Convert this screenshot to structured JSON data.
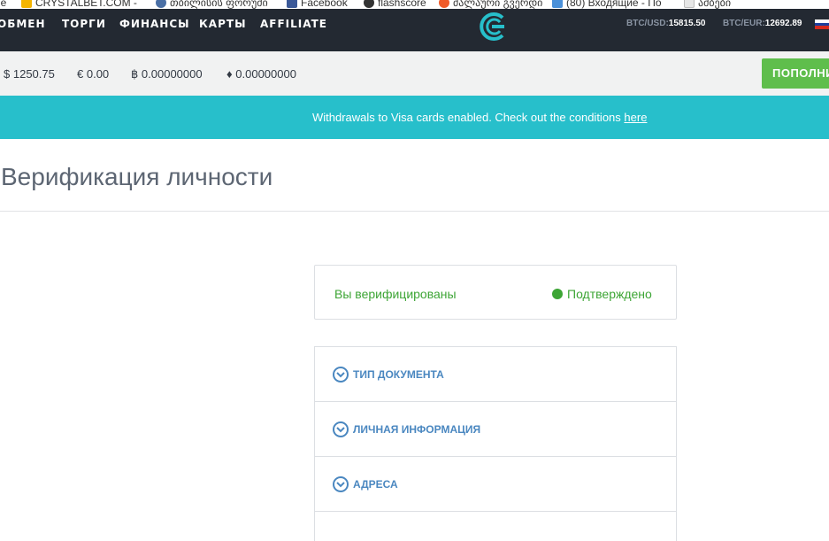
{
  "bookmarks": [
    {
      "label": "le",
      "color": "#bbbbbb"
    },
    {
      "label": "CRYSTALBET.COM - ",
      "color": "#f4b400"
    },
    {
      "label": "თბილისის ფორუმი",
      "color": "#4a6fa5"
    },
    {
      "label": "Facebook",
      "color": "#3b5998"
    },
    {
      "label": "flashscore",
      "color": "#333333"
    },
    {
      "label": "ძალაური გვერდი",
      "color": "#f05a28"
    },
    {
      "label": "(80) Входящие - По",
      "color": "#4a90d9"
    },
    {
      "label": "ამბები",
      "color": "#cccccc"
    }
  ],
  "nav": {
    "items": [
      "ОБМЕН",
      "ТОРГИ",
      "ФИНАНСЫ",
      "КАРТЫ",
      "AFFILIATE"
    ],
    "rates": [
      {
        "key": "BTC/USD:",
        "value": "15815.50"
      },
      {
        "key": "BTC/EUR:",
        "value": "12692.89"
      }
    ]
  },
  "balances": [
    {
      "symbol": "$",
      "value": "1250.75"
    },
    {
      "symbol": "€",
      "value": "0.00"
    },
    {
      "symbol": "฿",
      "value": "0.00000000"
    },
    {
      "symbol": "♦",
      "value": "0.00000000"
    }
  ],
  "topup_label": "ПОПОЛНИ",
  "notice": {
    "text": "Withdrawals to Visa cards enabled. Check out the conditions ",
    "link": "here"
  },
  "page_title": "Верификация личности",
  "verification": {
    "message": "Вы верифицированы",
    "status": "Подтверждено",
    "status_color": "#3da535"
  },
  "sections": [
    "ТИП ДОКУМЕНТА",
    "ЛИЧНАЯ ИНФОРМАЦИЯ",
    "АДРЕСА"
  ],
  "icons": {
    "section": "chevron-down-circle-icon",
    "logo": "cex-logo-icon"
  }
}
